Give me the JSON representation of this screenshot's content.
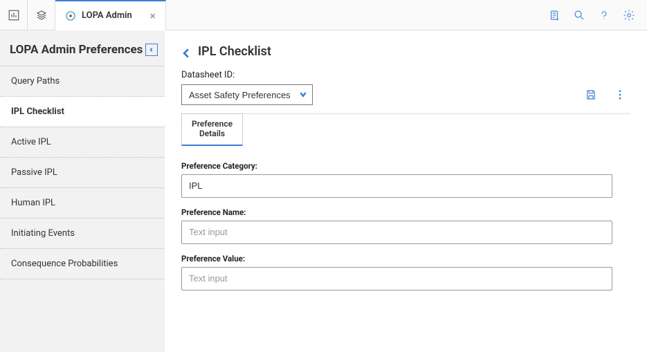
{
  "topbar": {
    "tab_label": "LOPA Admin"
  },
  "sidebar": {
    "title": "LOPA Admin Preferences",
    "items": [
      {
        "label": "Query Paths",
        "active": false
      },
      {
        "label": "IPL Checklist",
        "active": true
      },
      {
        "label": "Active IPL",
        "active": false
      },
      {
        "label": "Passive IPL",
        "active": false
      },
      {
        "label": "Human IPL",
        "active": false
      },
      {
        "label": "Initiating Events",
        "active": false
      },
      {
        "label": "Consequence Probabilities",
        "active": false
      }
    ]
  },
  "main": {
    "page_title": "IPL Checklist",
    "datasheet_label": "Datasheet ID:",
    "datasheet_value": "Asset Safety Preferences",
    "subtab_label": "Preference\nDetails",
    "fields": {
      "category_label": "Preference Category:",
      "category_value": "IPL",
      "name_label": "Preference Name:",
      "name_placeholder": "Text input",
      "value_label": "Preference Value:",
      "value_placeholder": "Text input"
    }
  }
}
